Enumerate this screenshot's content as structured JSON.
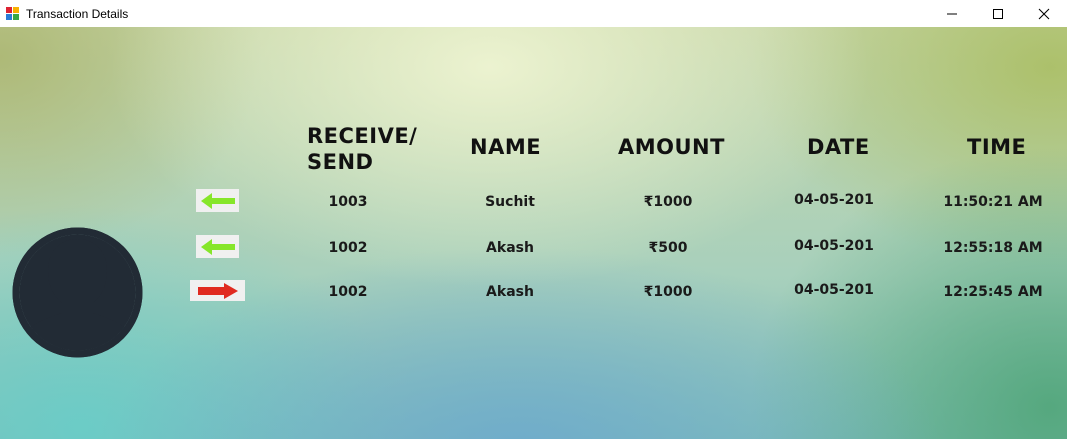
{
  "window": {
    "title": "Transaction Details",
    "controls": [
      "minimize-icon",
      "maximize-icon",
      "close-icon"
    ]
  },
  "headers": {
    "receive_send_line1": "RECEIVE/",
    "receive_send_line2": "SEND",
    "name": "NAME",
    "amount": "AMOUNT",
    "date": "DATE",
    "time": "TIME"
  },
  "rows": [
    {
      "direction": "receive",
      "arrow_color": "#86e62a",
      "account": "1003",
      "name": "Suchit",
      "amount": "₹1000",
      "date": "04-05-201",
      "time": "11:50:21 AM"
    },
    {
      "direction": "receive",
      "arrow_color": "#86e62a",
      "account": "1002",
      "name": "Akash",
      "amount": "₹500",
      "date": "04-05-201",
      "time": "12:55:18 AM"
    },
    {
      "direction": "send",
      "arrow_color": "#e02a20",
      "account": "1002",
      "name": "Akash",
      "amount": "₹1000",
      "date": "04-05-201",
      "time": "12:25:45 AM"
    }
  ],
  "avatar": {
    "icon": "user-avatar-icon",
    "color": "#222b35"
  }
}
